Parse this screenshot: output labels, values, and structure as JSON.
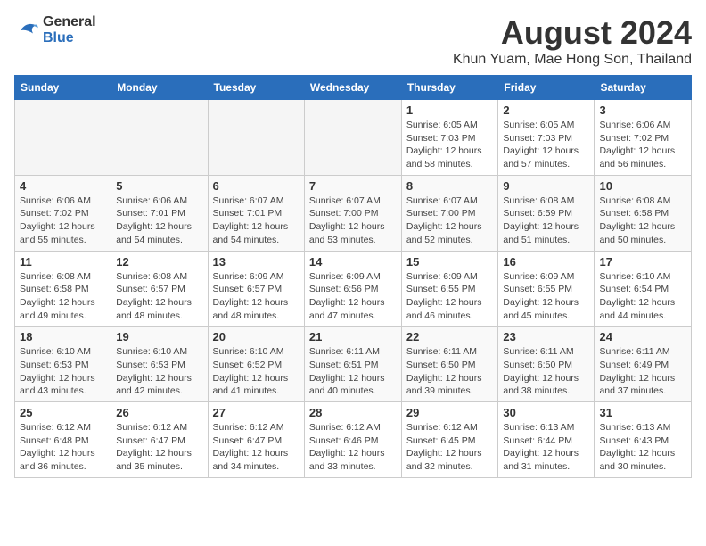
{
  "logo": {
    "line1": "General",
    "line2": "Blue"
  },
  "title": {
    "month_year": "August 2024",
    "location": "Khun Yuam, Mae Hong Son, Thailand"
  },
  "headers": [
    "Sunday",
    "Monday",
    "Tuesday",
    "Wednesday",
    "Thursday",
    "Friday",
    "Saturday"
  ],
  "weeks": [
    [
      {
        "day": "",
        "info": ""
      },
      {
        "day": "",
        "info": ""
      },
      {
        "day": "",
        "info": ""
      },
      {
        "day": "",
        "info": ""
      },
      {
        "day": "1",
        "info": "Sunrise: 6:05 AM\nSunset: 7:03 PM\nDaylight: 12 hours\nand 58 minutes."
      },
      {
        "day": "2",
        "info": "Sunrise: 6:05 AM\nSunset: 7:03 PM\nDaylight: 12 hours\nand 57 minutes."
      },
      {
        "day": "3",
        "info": "Sunrise: 6:06 AM\nSunset: 7:02 PM\nDaylight: 12 hours\nand 56 minutes."
      }
    ],
    [
      {
        "day": "4",
        "info": "Sunrise: 6:06 AM\nSunset: 7:02 PM\nDaylight: 12 hours\nand 55 minutes."
      },
      {
        "day": "5",
        "info": "Sunrise: 6:06 AM\nSunset: 7:01 PM\nDaylight: 12 hours\nand 54 minutes."
      },
      {
        "day": "6",
        "info": "Sunrise: 6:07 AM\nSunset: 7:01 PM\nDaylight: 12 hours\nand 54 minutes."
      },
      {
        "day": "7",
        "info": "Sunrise: 6:07 AM\nSunset: 7:00 PM\nDaylight: 12 hours\nand 53 minutes."
      },
      {
        "day": "8",
        "info": "Sunrise: 6:07 AM\nSunset: 7:00 PM\nDaylight: 12 hours\nand 52 minutes."
      },
      {
        "day": "9",
        "info": "Sunrise: 6:08 AM\nSunset: 6:59 PM\nDaylight: 12 hours\nand 51 minutes."
      },
      {
        "day": "10",
        "info": "Sunrise: 6:08 AM\nSunset: 6:58 PM\nDaylight: 12 hours\nand 50 minutes."
      }
    ],
    [
      {
        "day": "11",
        "info": "Sunrise: 6:08 AM\nSunset: 6:58 PM\nDaylight: 12 hours\nand 49 minutes."
      },
      {
        "day": "12",
        "info": "Sunrise: 6:08 AM\nSunset: 6:57 PM\nDaylight: 12 hours\nand 48 minutes."
      },
      {
        "day": "13",
        "info": "Sunrise: 6:09 AM\nSunset: 6:57 PM\nDaylight: 12 hours\nand 48 minutes."
      },
      {
        "day": "14",
        "info": "Sunrise: 6:09 AM\nSunset: 6:56 PM\nDaylight: 12 hours\nand 47 minutes."
      },
      {
        "day": "15",
        "info": "Sunrise: 6:09 AM\nSunset: 6:55 PM\nDaylight: 12 hours\nand 46 minutes."
      },
      {
        "day": "16",
        "info": "Sunrise: 6:09 AM\nSunset: 6:55 PM\nDaylight: 12 hours\nand 45 minutes."
      },
      {
        "day": "17",
        "info": "Sunrise: 6:10 AM\nSunset: 6:54 PM\nDaylight: 12 hours\nand 44 minutes."
      }
    ],
    [
      {
        "day": "18",
        "info": "Sunrise: 6:10 AM\nSunset: 6:53 PM\nDaylight: 12 hours\nand 43 minutes."
      },
      {
        "day": "19",
        "info": "Sunrise: 6:10 AM\nSunset: 6:53 PM\nDaylight: 12 hours\nand 42 minutes."
      },
      {
        "day": "20",
        "info": "Sunrise: 6:10 AM\nSunset: 6:52 PM\nDaylight: 12 hours\nand 41 minutes."
      },
      {
        "day": "21",
        "info": "Sunrise: 6:11 AM\nSunset: 6:51 PM\nDaylight: 12 hours\nand 40 minutes."
      },
      {
        "day": "22",
        "info": "Sunrise: 6:11 AM\nSunset: 6:50 PM\nDaylight: 12 hours\nand 39 minutes."
      },
      {
        "day": "23",
        "info": "Sunrise: 6:11 AM\nSunset: 6:50 PM\nDaylight: 12 hours\nand 38 minutes."
      },
      {
        "day": "24",
        "info": "Sunrise: 6:11 AM\nSunset: 6:49 PM\nDaylight: 12 hours\nand 37 minutes."
      }
    ],
    [
      {
        "day": "25",
        "info": "Sunrise: 6:12 AM\nSunset: 6:48 PM\nDaylight: 12 hours\nand 36 minutes."
      },
      {
        "day": "26",
        "info": "Sunrise: 6:12 AM\nSunset: 6:47 PM\nDaylight: 12 hours\nand 35 minutes."
      },
      {
        "day": "27",
        "info": "Sunrise: 6:12 AM\nSunset: 6:47 PM\nDaylight: 12 hours\nand 34 minutes."
      },
      {
        "day": "28",
        "info": "Sunrise: 6:12 AM\nSunset: 6:46 PM\nDaylight: 12 hours\nand 33 minutes."
      },
      {
        "day": "29",
        "info": "Sunrise: 6:12 AM\nSunset: 6:45 PM\nDaylight: 12 hours\nand 32 minutes."
      },
      {
        "day": "30",
        "info": "Sunrise: 6:13 AM\nSunset: 6:44 PM\nDaylight: 12 hours\nand 31 minutes."
      },
      {
        "day": "31",
        "info": "Sunrise: 6:13 AM\nSunset: 6:43 PM\nDaylight: 12 hours\nand 30 minutes."
      }
    ]
  ]
}
